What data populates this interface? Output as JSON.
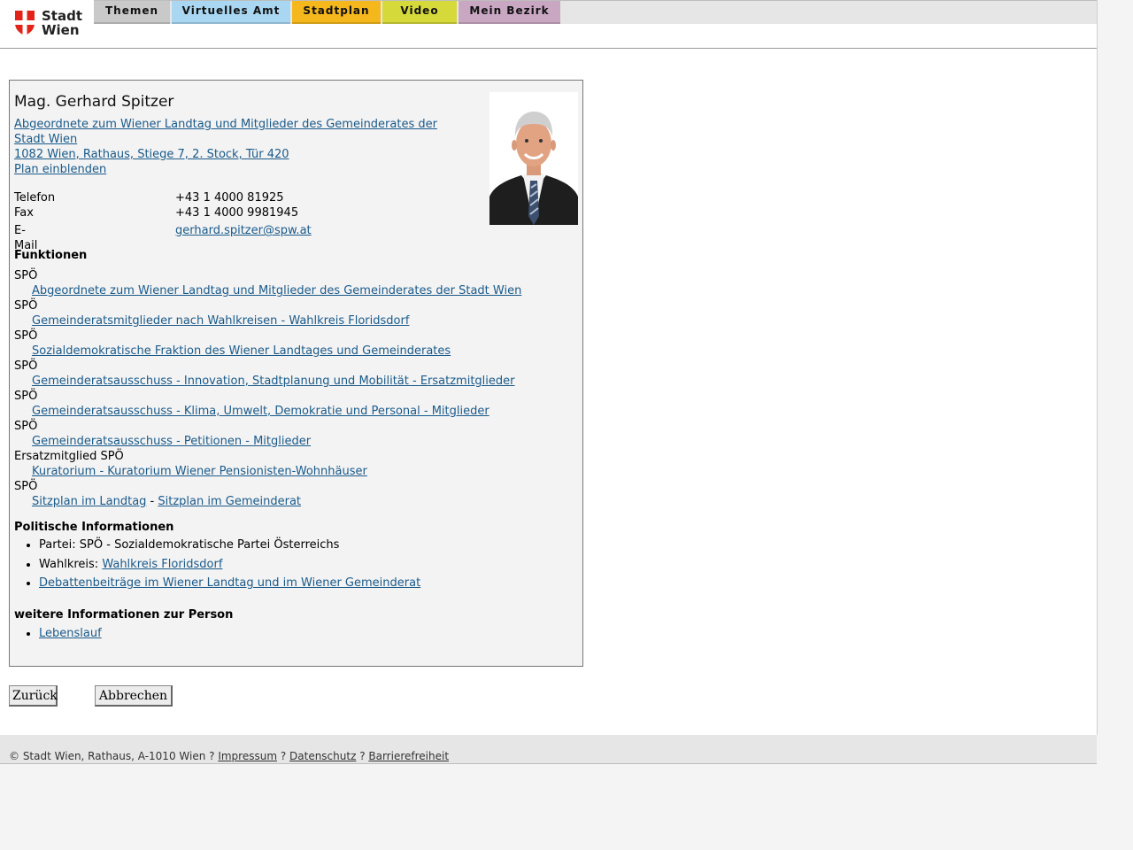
{
  "header": {
    "logo_text_1": "Stadt",
    "logo_text_2": "Wien",
    "tabs": [
      {
        "label": "Themen",
        "color": "#c9c9c9"
      },
      {
        "label": "Virtuelles Amt",
        "color": "#a9d7f2"
      },
      {
        "label": "Stadtplan",
        "color": "#f5b81c"
      },
      {
        "label": "Video",
        "color": "#d5d93a"
      },
      {
        "label": "Mein Bezirk",
        "color": "#c9a7c3"
      }
    ]
  },
  "person": {
    "name": "Mag. Gerhard Spitzer",
    "address_line_1": "Abgeordnete zum Wiener Landtag und Mitglieder des Gemeinderates der",
    "address_line_2": "Stadt Wien ",
    "address_line_3": "1082 Wien, Rathaus, Stiege 7, 2. Stock, Tür 420",
    "plan_link": "Plan einblenden",
    "contact": {
      "phone_label": "Telefon",
      "phone": "+43 1 4000 81925",
      "fax_label": "Fax",
      "fax": "+43 1 4000 9981945",
      "email_label": "E-Mail",
      "email": "gerhard.spitzer@spw.at"
    }
  },
  "functions": {
    "heading": "Funktionen",
    "items": [
      {
        "party": "SPÖ",
        "link": "Abgeordnete zum Wiener Landtag und Mitglieder des Gemeinderates der Stadt Wien"
      },
      {
        "party": "SPÖ",
        "link": "Gemeinderatsmitglieder nach Wahlkreisen - Wahlkreis Floridsdorf"
      },
      {
        "party": "SPÖ",
        "link": "Sozialdemokratische Fraktion des Wiener Landtages und Gemeinderates"
      },
      {
        "party": "SPÖ",
        "link": "Gemeinderatsausschuss - Innovation, Stadtplanung und Mobilität - Ersatzmitglieder"
      },
      {
        "party": "SPÖ",
        "link": "Gemeinderatsausschuss - Klima, Umwelt, Demokratie und Personal - Mitglieder"
      },
      {
        "party": "SPÖ",
        "link": "Gemeinderatsausschuss - Petitionen - Mitglieder"
      },
      {
        "party": "Ersatzmitglied SPÖ",
        "link": "Kuratorium - Kuratorium Wiener Pensionisten-Wohnhäuser"
      }
    ],
    "last_party": "SPÖ",
    "seat_link_1": "Sitzplan im Landtag",
    "seat_sep": " - ",
    "seat_link_2": "Sitzplan im Gemeinderat"
  },
  "political": {
    "heading": "Politische Informationen",
    "party_text": "Partei: SPÖ - Sozialdemokratische Partei Österreichs",
    "district_label": "Wahlkreis: ",
    "district_link": "Wahlkreis Floridsdorf",
    "debates_link": "Debattenbeiträge im Wiener Landtag und im Wiener Gemeinderat"
  },
  "more": {
    "heading": "weitere Informationen zur Person",
    "cv_link": "Lebenslauf"
  },
  "buttons": {
    "back": "Zurück",
    "cancel": "Abbrechen"
  },
  "footer": {
    "copyright": "© Stadt Wien, Rathaus, A-1010 Wien ? ",
    "impressum": "Impressum",
    "sep1": " ? ",
    "datenschutz": "Datenschutz",
    "sep2": " ? ",
    "barrierefreiheit": "Barrierefreiheit"
  }
}
